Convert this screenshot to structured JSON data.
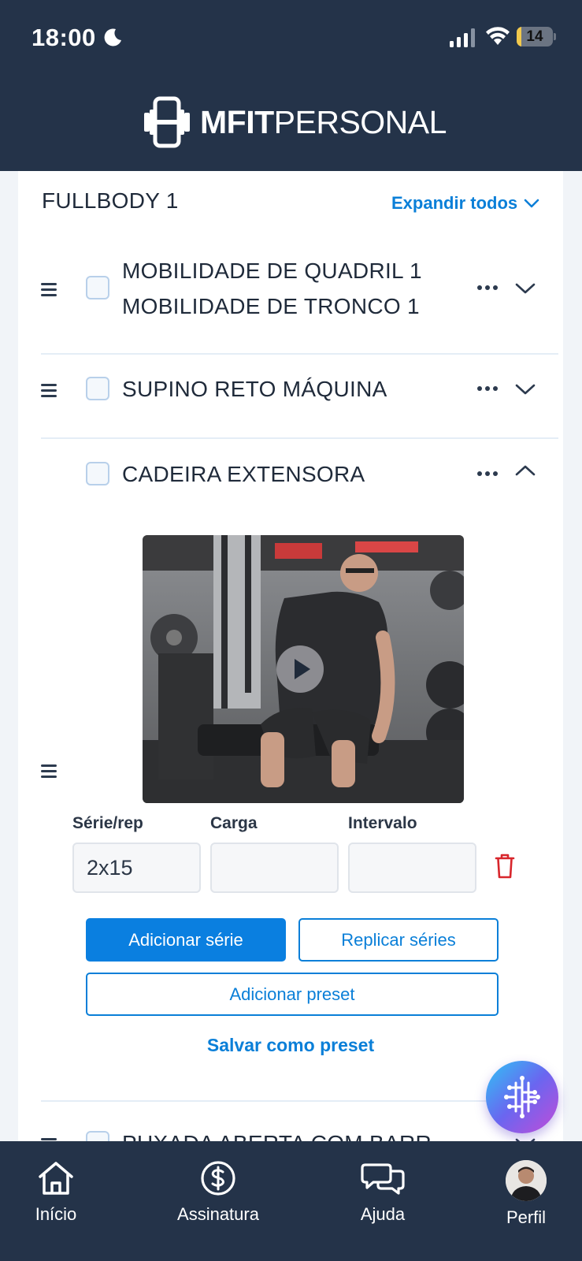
{
  "status_bar": {
    "time": "18:00",
    "battery": "14",
    "battery_level": 0.14
  },
  "header": {
    "brand_bold": "MFIT",
    "brand_light": "PERSONAL"
  },
  "workout": {
    "title": "FULLBODY 1",
    "expand_all_label": "Expandir todos"
  },
  "exercises": [
    {
      "name_line1": "MOBILIDADE DE QUADRIL 1",
      "name_line2": "MOBILIDADE DE TRONCO 1"
    },
    {
      "name": "SUPINO RETO MÁQUINA"
    },
    {
      "name": "CADEIRA EXTENSORA"
    },
    {
      "name": "PUXADA ABERTA COM BARR"
    }
  ],
  "series": {
    "label_reps": "Série/rep",
    "label_load": "Carga",
    "label_rest": "Intervalo",
    "reps_value": "2x15",
    "load_value": "",
    "rest_value": ""
  },
  "actions": {
    "add_series": "Adicionar série",
    "replicate_series": "Replicar séries",
    "add_preset": "Adicionar preset",
    "save_preset": "Salvar como preset"
  },
  "nav": {
    "home": "Início",
    "subscription": "Assinatura",
    "help": "Ajuda",
    "profile": "Perfil"
  },
  "colors": {
    "header_bg": "#243349",
    "accent": "#0a7fe0",
    "delete": "#d8262c"
  }
}
